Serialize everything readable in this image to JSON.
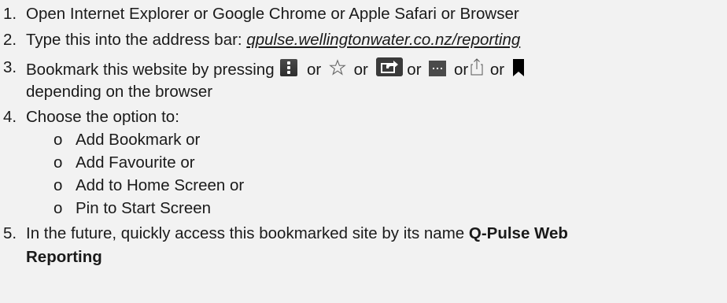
{
  "steps": [
    {
      "num": "1.",
      "text": "Open Internet Explorer or Google Chrome or Apple Safari or Browser"
    },
    {
      "num": "2.",
      "text_before": "Type this into the address bar: ",
      "link": "qpulse.wellingtonwater.co.nz/reporting"
    },
    {
      "num": "3.",
      "text_before": "Bookmark this website by pressing",
      "or": "or",
      "continuation": "depending on the browser",
      "icons": [
        "kebab-menu-icon",
        "star-icon",
        "share-icon",
        "more-dots-icon",
        "share-upload-icon",
        "bookmark-icon"
      ]
    },
    {
      "num": "4.",
      "text": "Choose the option to:",
      "bullet": "o",
      "options": [
        "Add Bookmark or",
        "Add Favourite or",
        "Add to Home Screen or",
        "Pin to Start Screen"
      ]
    },
    {
      "num": "5.",
      "text_before": "In the future, quickly access this bookmarked site by its name ",
      "bold_name_line1": "Q-Pulse Web",
      "bold_name_line2": "Reporting"
    }
  ]
}
